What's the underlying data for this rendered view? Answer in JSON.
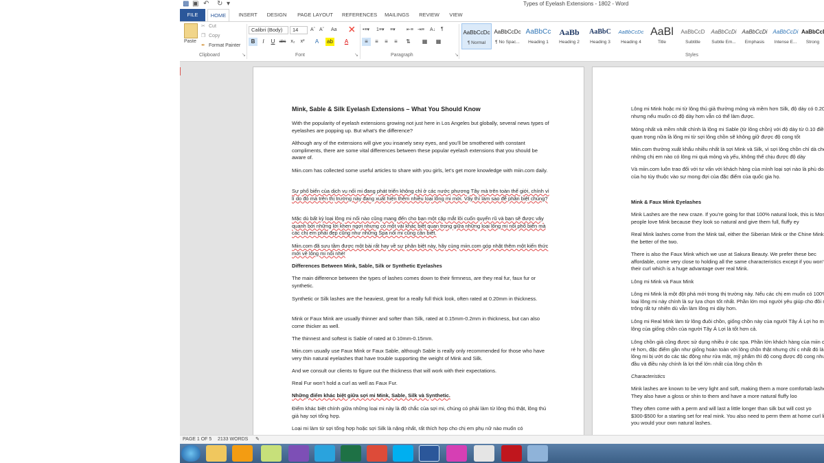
{
  "window": {
    "title": "Types of Eyelash Extensions - 1802 - Word"
  },
  "ribbon": {
    "tabs": [
      "FILE",
      "HOME",
      "INSERT",
      "DESIGN",
      "PAGE LAYOUT",
      "REFERENCES",
      "MAILINGS",
      "REVIEW",
      "VIEW"
    ],
    "clipboard": {
      "cut": "Cut",
      "copy": "Copy",
      "paste": "Paste",
      "format_painter": "Format Painter",
      "label": "Clipboard"
    },
    "font": {
      "name": "Calibri (Body)",
      "size": "14",
      "label": "Font",
      "change_case": "Aa"
    },
    "paragraph": {
      "label": "Paragraph"
    },
    "styles": {
      "label": "Styles",
      "items": [
        {
          "preview": "AaBbCcDc",
          "name": "¶ Normal"
        },
        {
          "preview": "AaBbCcDc",
          "name": "¶ No Spac..."
        },
        {
          "preview": "AaBbCc",
          "name": "Heading 1"
        },
        {
          "preview": "AaBb",
          "name": "Heading 2"
        },
        {
          "preview": "AaBbC",
          "name": "Heading 3"
        },
        {
          "preview": "AaBbCcDc",
          "name": "Heading 4"
        },
        {
          "preview": "AaBl",
          "name": "Title"
        },
        {
          "preview": "AaBbCcD",
          "name": "Subtitle"
        },
        {
          "preview": "AaBbCcDi",
          "name": "Subtle Em..."
        },
        {
          "preview": "AaBbCcDi",
          "name": "Emphasis"
        },
        {
          "preview": "AaBbCcDi",
          "name": "Intense E..."
        },
        {
          "preview": "AaBbCcDi",
          "name": "Strong"
        }
      ]
    }
  },
  "page1": {
    "heading": "Mink, Sable & Silk Eyelash Extensions – What You Should Know",
    "paragraphs": [
      "With the popularity of eyelash extensions growing not just here in Los Angeles but globally, several news types of eyelashes are popping up. But what’s the difference?",
      "Although any of the extensions will give you insanely sexy eyes, and you’ll be smothered with constant compliments, there are some vital differences between these popular eyelash extensions that you should be aware of.",
      "Miin.com has collected some useful articles to share with you girls, let’s get more knowledge with miin.com daily.",
      "Sự phổ biến của dịch vụ nối mi đang phát triển không chỉ ở các nước phương Tây mà trên toàn thế giới, chính vì lí do đó mà trên thị trường này đang xuất hiện thêm nhiều loại lông mi mới. Vậy thì làm sao để phân biệt chúng?",
      "Mặc dù bất kỳ loại lông mi nối nào cũng mang đến cho bạn một cặp mắt lôi cuốn quyến rũ và bạn sẽ được vây quanh bởi những lời khen ngợi nhưng có một vài khác biệt quan trọng giữa những loại lông mi nối phổ biến mà các chị em phải đẹp cũng như những Spa nối mi cũng cần biết.",
      "Miin.com đã sưu tầm được một bài rất hay về sự phân biệt này, hãy cùng miin.com góp nhặt thêm một kiến thức mới về lông mi nối nhé!",
      "Differences Between Mink, Sable, Silk or Synthetic Eyelashes",
      "The main difference between the types of lashes comes down to their firmness, are they real fur, faux fur or synthetic.",
      "Synthetic or Silk lashes are the heaviest, great for a really full thick look, often rated at 0.20mm in thickness.",
      "Mink or Faux Mink are usually thinner and softer than Silk, rated at 0.15mm-0.2mm in thickness, but can also come thicker as well.",
      "The thinnest and softest is Sable of rated at 0.10mm-0.15mm.",
      "Miin.com usually use Faux Mink or Faux Sable, although Sable is really only recommended for those who have very thin natural eyelashes that have trouble supporting the weight of Mink and Silk.",
      "And we consult our clients to figure out the thickness that will work with their expectations.",
      "Real Fur won’t hold a curl as well as Faux Fur.",
      "Những điểm khác biệt giữa sợi mi Mink, Sable, Silk và Synthetic.",
      "Điểm khác biệt chính giữa những loại mi này là độ chắc của sợi mi, chúng có phải làm từ lông thú thật, lông thú giả hay sợi tổng hợp.",
      "Loại mi làm từ sợi tổng hợp hoặc sợi Silk là nặng nhất, rất thích hợp cho chị em phụ nữ nào muốn có"
    ]
  },
  "page2": {
    "paragraphs": [
      "Lông mi Mink hoặc mi từ lông thú giả thường mỏng và mềm hơn Silk, độ dày có 0.20mm, nhưng nếu muốn có độ dày hơn vẫn có thể làm được.",
      "Mỏng nhất và mềm nhất chính là lông mi Sable (từ lông chồn) với độ dày từ 0.10 điều quan trọng nữa là lông mi từ sợi lông chồn sẽ không giữ được độ cong tốt",
      "Miin.com thường xuất khẩu nhiều nhất là sợi Mink và Silk, vì sợi lông chồn chỉ dà cho những chị em nào có lông mi quá mỏng và yếu, không thể chịu được độ dày",
      "Và miin.com luôn trao đổi với tư vấn với khách hàng của mình loại sợi nào là phù doanh của họ tùy thuộc vào sự mong đợi của đặc điểm của quốc gia họ.",
      "Mink & Faux Mink Eyelashes",
      "Mink Lashes are the new craze. If you’re going for that 100% natural look, this is Most people love Mink because they look so natural and give them full, fluffy ey",
      "Real Mink lashes come from the Mink tail, either the Siberian Mink or the Chine Mink are the better of the two.",
      "There is also the Faux Mink which we use at Sakura Beauty. We prefer these bec affordable, come very close to holding all the same characteristics except if you won’t lose their curl which is a huge advantage over real Mink.",
      "Lông mi Mink và Faux Mink",
      "Lông mi Mink là một đột phá mới trong thị trường này. Nếu các chị em muốn có 100% thì loại lông mi này chính là sự lựa chọn tốt nhất. Phần lớn mọi người yêu giúp cho đôi mắt trông rất tự nhiên dù vẫn làm lông mi dày hơn.",
      "Lông mi Real Mink làm từ lông đuôi chồn, giống chồn này của người Tây Á Lợi ho mi từ lông của giống chồn của người Tây Á Lợi là tốt hơn cả.",
      "Lông chồn giả cũng được sử dụng nhiều ở các spa. Phần lớn khách hàng của miin chúng rẻ hơn, đặc điểm gần như giống hoàn toàn với lông chồn thật nhưng chỉ c nhất đó là khi lông mi bị ướt do các tác động như rửa mặt, mỹ phẩm thì độ cong được độ cong như ban đầu và điều này chính là lợi thế lớn nhất của lông chồn th",
      "Characteristics",
      "Mink lashes are known to be very light and soft, making them a more comfortab lashes. They also have a gloss or shin to them and have a more natural fluffy loo",
      "They often come with a perm and will last a little longer than silk but will cost yo $300-$500 for a starting set for real mink. You also need to perm them at home curl like you would your own natural lashes."
    ]
  },
  "status": {
    "page": "PAGE 1 OF 5",
    "words": "2133 WORDS"
  },
  "taskbar": {
    "apps": [
      "start-orb",
      "file-explorer-icon",
      "media-player-icon",
      "notes-icon",
      "viber-icon",
      "telegram-icon",
      "excel-icon",
      "chrome-icon",
      "skype-icon",
      "word-icon",
      "itunes-icon",
      "drawing-icon",
      "acrobat-icon",
      "paint-icon"
    ]
  }
}
